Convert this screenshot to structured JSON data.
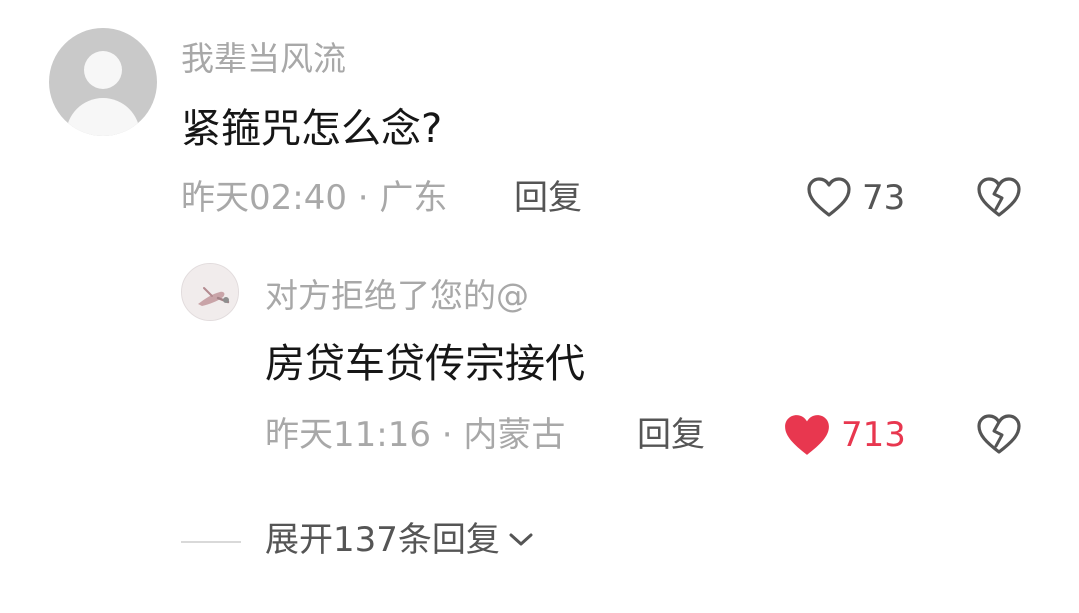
{
  "comment": {
    "username": "我辈当风流",
    "content": "紧箍咒怎么念?",
    "timestamp": "昨天02:40 · 广东",
    "reply_label": "回复",
    "likes": "73",
    "liked": false,
    "dislike_icon": "broken-heart-icon"
  },
  "reply": {
    "username": "对方拒绝了您的@",
    "content": "房贷车贷传宗接代",
    "timestamp": "昨天11:16 · 内蒙古",
    "reply_label": "回复",
    "likes": "713",
    "liked": true,
    "dislike_icon": "broken-heart-icon"
  },
  "expand": {
    "label": "展开137条回复"
  },
  "colors": {
    "like_active": "#e8374f",
    "muted_text": "#a8a8a8",
    "secondary_text": "#555555",
    "primary_text": "#161616"
  }
}
